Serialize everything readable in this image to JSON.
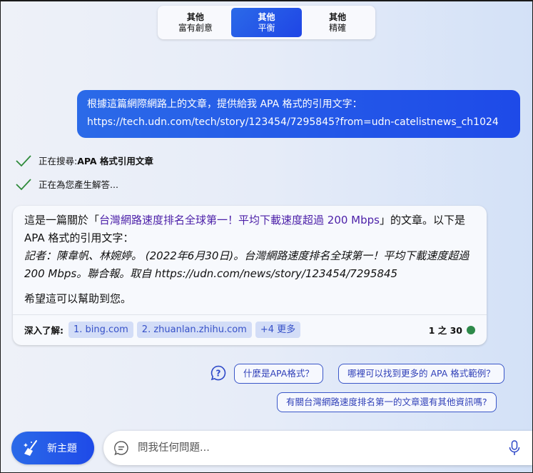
{
  "tone_selector": {
    "options": [
      {
        "line1": "其他",
        "line2": "富有創意",
        "active": false
      },
      {
        "line1": "其他",
        "line2": "平衡",
        "active": true
      },
      {
        "line1": "其他",
        "line2": "精確",
        "active": false
      }
    ]
  },
  "user_message": {
    "line1": "根據這篇網際網路上的文章，提供給我 APA 格式的引用文字：",
    "line2": "https://tech.udn.com/tech/story/123454/7295845?from=udn-catelistnews_ch1024"
  },
  "status": [
    {
      "prefix": "正在搜尋: ",
      "bold": "APA 格式引用文章",
      "icon": "check-icon"
    },
    {
      "prefix": "正在為您產生解答...",
      "bold": "",
      "icon": "check-icon"
    }
  ],
  "bot_response": {
    "intro_before": "這是一篇關於「",
    "article_title": "台灣網路速度排名全球第一！平均下載速度超過 200 Mbps",
    "intro_after": "」的文章。以下是 APA 格式的引用文字：",
    "citation": "記者：陳韋帆、林婉婷。 (2022年6月30日)。台灣網路速度排名全球第一！平均下載速度超過 200 Mbps。聯合報。取自 https://udn.com/news/story/123454/7295845",
    "closing": "希望這可以幫助到您。",
    "learn_more_label": "深入了解:",
    "sources": [
      "1. bing.com",
      "2. zhuanlan.zhihu.com",
      "+4 更多"
    ],
    "counter": "1 之 30",
    "counter_dot_color": "#2e8a4a"
  },
  "suggestions": [
    "什麼是APA格式？",
    "哪裡可以找到更多的 APA 格式範例？",
    "有關台灣網路速度排名第一的文章還有其他資訊嗎?"
  ],
  "composer": {
    "new_topic_label": "新主題",
    "placeholder": "問我任何問題..."
  },
  "colors": {
    "accent": "#1f4fe6",
    "link": "#4b1fa8",
    "chip_bg": "#d3ddf7"
  }
}
